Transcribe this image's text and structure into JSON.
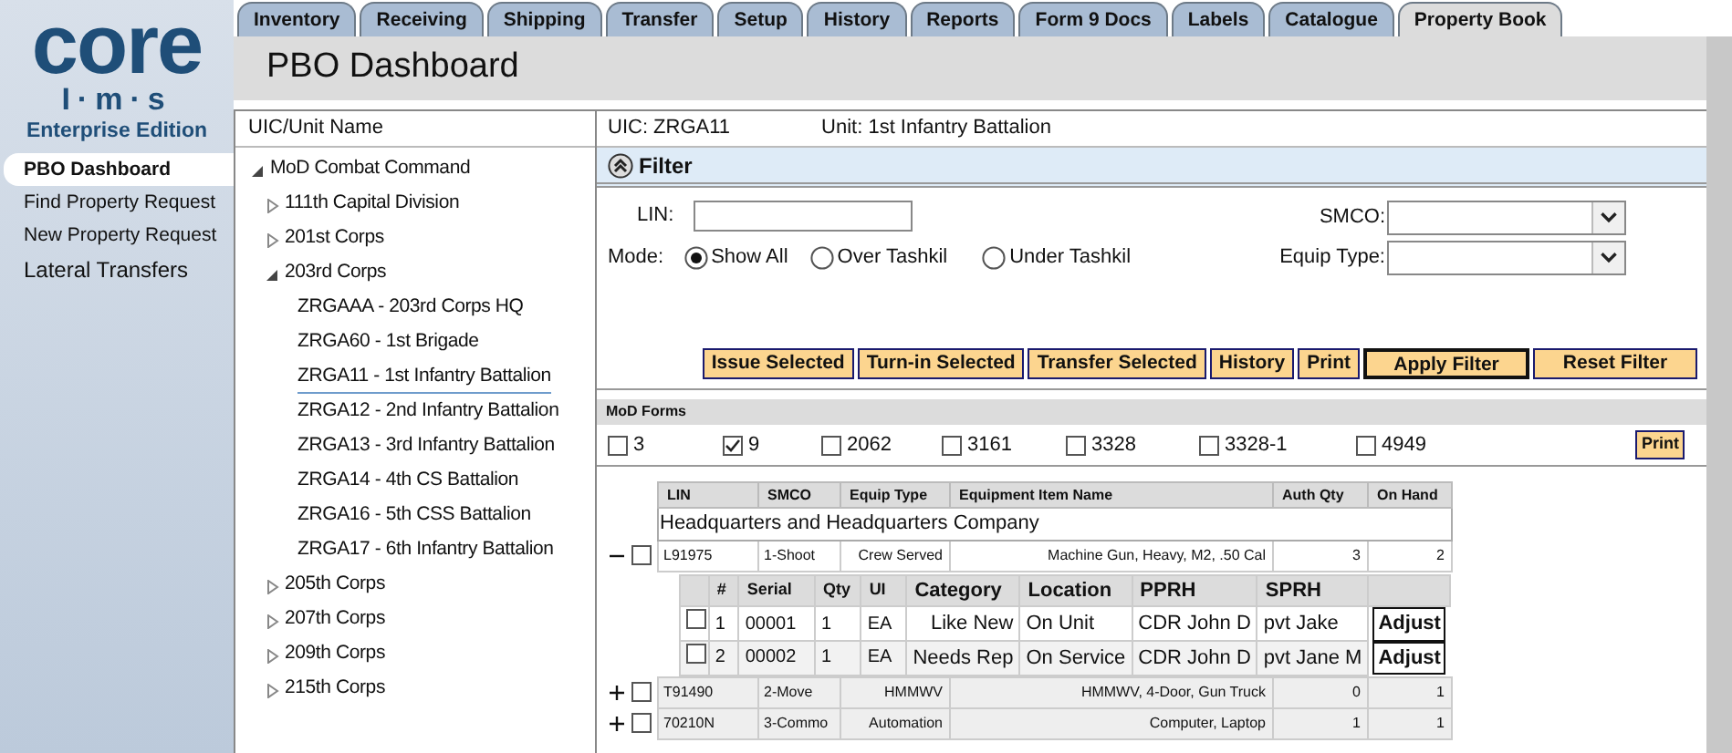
{
  "logo": {
    "wordmark": "core",
    "subtitle": "I·m·s",
    "edition": "Enterprise Edition"
  },
  "sidebar": {
    "items": [
      {
        "label": "PBO Dashboard",
        "selected": true
      },
      {
        "label": "Find Property Request",
        "selected": false
      },
      {
        "label": "New Property Request",
        "selected": false
      },
      {
        "label": "Lateral Transfers",
        "selected": false
      }
    ]
  },
  "tabs": [
    {
      "label": "Inventory",
      "selected": false
    },
    {
      "label": "Receiving",
      "selected": false
    },
    {
      "label": "Shipping",
      "selected": false
    },
    {
      "label": "Transfer",
      "selected": false
    },
    {
      "label": "Setup",
      "selected": false
    },
    {
      "label": "History",
      "selected": false
    },
    {
      "label": "Reports",
      "selected": false
    },
    {
      "label": "Form 9 Docs",
      "selected": false
    },
    {
      "label": "Labels",
      "selected": false
    },
    {
      "label": "Catalogue",
      "selected": false
    },
    {
      "label": "Property Book",
      "selected": true
    }
  ],
  "page_title": "PBO Dashboard",
  "tree": {
    "heading": "UIC/Unit Name",
    "nodes": [
      {
        "label": "MoD Combat Command",
        "expanded": true,
        "children": [
          {
            "label": "111th Capital Division",
            "expanded": false
          },
          {
            "label": "201st Corps",
            "expanded": false
          },
          {
            "label": "203rd Corps",
            "expanded": true,
            "children": [
              {
                "label": "ZRGAAA - 203rd Corps HQ",
                "selected": false
              },
              {
                "label": "ZRGA60 - 1st Brigade",
                "selected": false
              },
              {
                "label": "ZRGA11 - 1st Infantry Battalion",
                "selected": true
              },
              {
                "label": "ZRGA12 - 2nd Infantry Battalion",
                "selected": false
              },
              {
                "label": "ZRGA13 - 3rd Infantry Battalion",
                "selected": false
              },
              {
                "label": "ZRGA14 - 4th CS Battalion",
                "selected": false
              },
              {
                "label": "ZRGA16 - 5th CSS Battalion",
                "selected": false
              },
              {
                "label": "ZRGA17 - 6th Infantry Battalion",
                "selected": false
              }
            ]
          },
          {
            "label": "205th Corps",
            "expanded": false
          },
          {
            "label": "207th Corps",
            "expanded": false
          },
          {
            "label": "209th Corps",
            "expanded": false
          },
          {
            "label": "215th Corps",
            "expanded": false
          }
        ]
      }
    ]
  },
  "unit_bar": {
    "uic": "UIC: ZRGA11",
    "unit": "Unit: 1st Infantry Battalion"
  },
  "filter": {
    "title": "Filter",
    "expanded": true,
    "lin_label": "LIN:",
    "mode_label": "Mode:",
    "modes": [
      {
        "label": "Show All",
        "selected": true
      },
      {
        "label": "Over Tashkil",
        "selected": false
      },
      {
        "label": "Under Tashkil",
        "selected": false
      }
    ],
    "smco_label": "SMCO:",
    "equip_type_label": "Equip Type:",
    "buttons": [
      {
        "label": "Issue Selected",
        "emphasized": false
      },
      {
        "label": "Turn-in Selected",
        "emphasized": false
      },
      {
        "label": "Transfer Selected",
        "emphasized": false
      },
      {
        "label": "History",
        "emphasized": false
      },
      {
        "label": "Print",
        "emphasized": false
      },
      {
        "label": "Apply Filter",
        "emphasized": true
      },
      {
        "label": "Reset Filter",
        "emphasized": false
      }
    ]
  },
  "forms": {
    "title": "MoD Forms",
    "print": "Print",
    "items": [
      {
        "label": "3",
        "checked": false
      },
      {
        "label": "9",
        "checked": true
      },
      {
        "label": "2062",
        "checked": false
      },
      {
        "label": "3161",
        "checked": false
      },
      {
        "label": "3328",
        "checked": false
      },
      {
        "label": "3328-1",
        "checked": false
      },
      {
        "label": "4949",
        "checked": false
      }
    ]
  },
  "table": {
    "columns": [
      "LIN",
      "SMCO",
      "Equip Type",
      "Equipment Item Name",
      "Auth Qty",
      "On Hand"
    ],
    "group": "Headquarters and Headquarters Company",
    "rows": [
      {
        "expanded": true,
        "checked": false,
        "cells": [
          "L91975",
          "1-Shoot",
          "Crew Served",
          "Machine Gun, Heavy, M2, .50 Cal",
          "3",
          "2"
        ],
        "items": {
          "columns": [
            "#",
            "Serial",
            "Qty",
            "UI",
            "Category",
            "Location",
            "PPRH",
            "SPRH"
          ],
          "rows": [
            {
              "checked": false,
              "cells": [
                "1",
                "00001",
                "1",
                "EA",
                "Like New",
                "On Unit",
                "CDR John D",
                "pvt Jake"
              ],
              "button": "Adjust"
            },
            {
              "checked": false,
              "cells": [
                "2",
                "00002",
                "1",
                "EA",
                "Needs Rep",
                "On Service",
                "CDR John D",
                "pvt Jane M"
              ],
              "button": "Adjust"
            }
          ]
        }
      },
      {
        "expanded": false,
        "checked": false,
        "cells": [
          "T91490",
          "2-Move",
          "HMMWV",
          "HMMWV, 4-Door, Gun Truck",
          "0",
          "1"
        ]
      },
      {
        "expanded": false,
        "checked": false,
        "cells": [
          "70210N",
          "3-Commo",
          "Automation",
          "Computer, Laptop",
          "1",
          "1"
        ]
      }
    ]
  }
}
